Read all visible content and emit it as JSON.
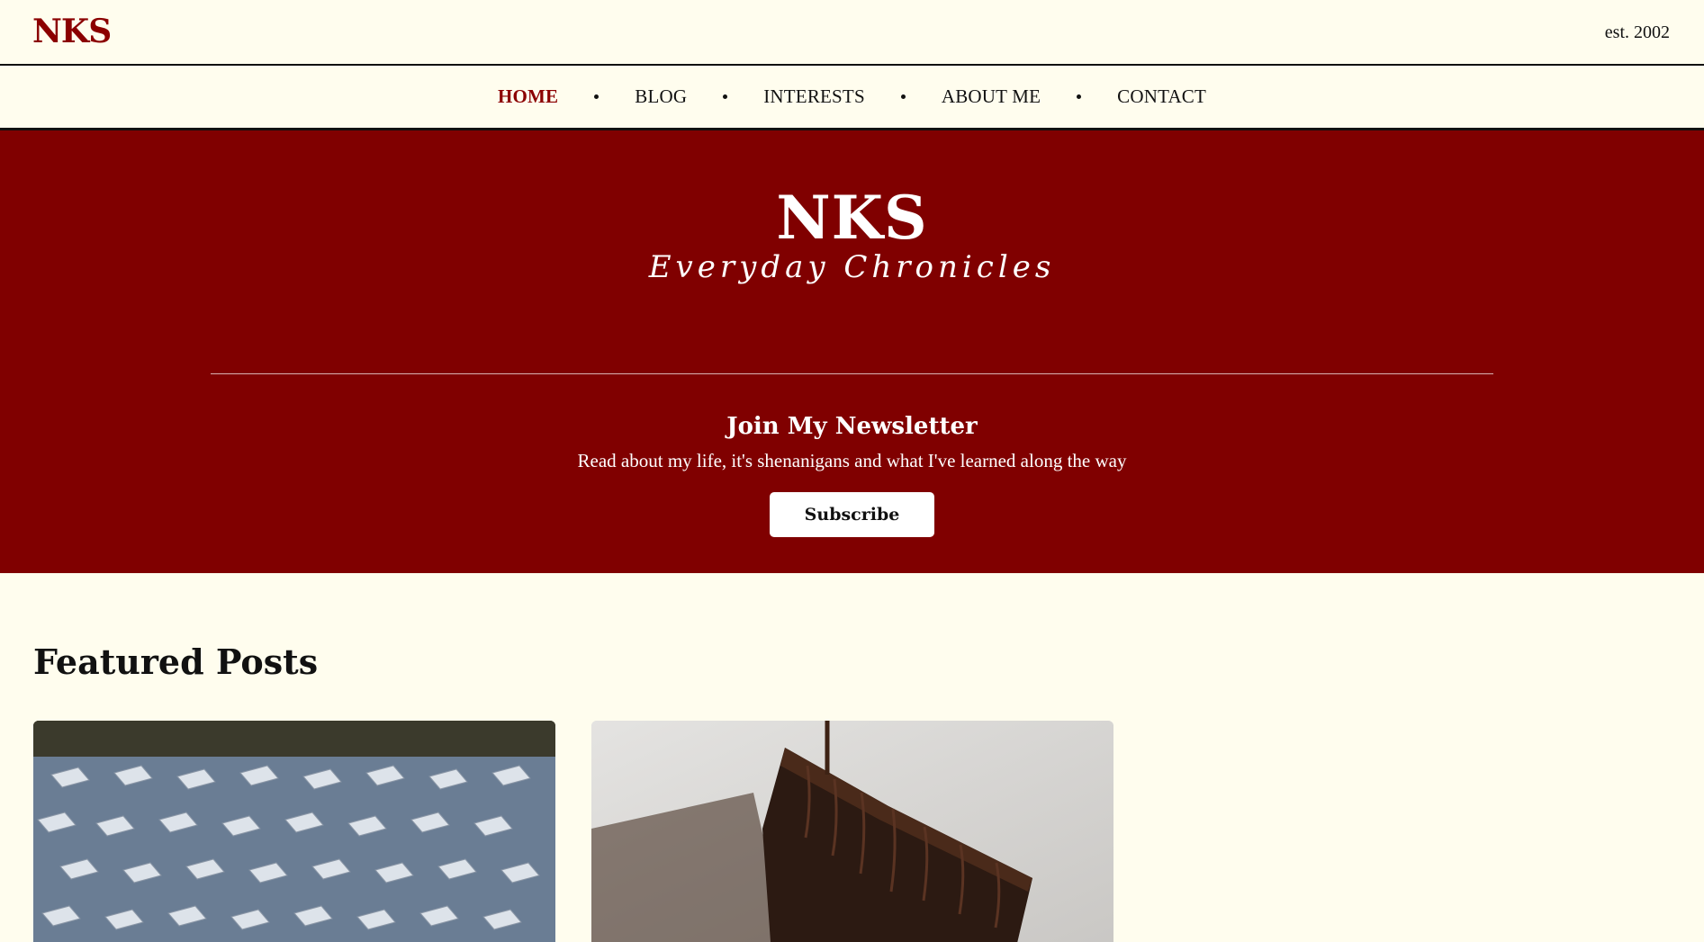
{
  "header": {
    "brand": "NKS",
    "established": "est. 2002"
  },
  "nav": {
    "items": [
      {
        "label": "HOME",
        "active": true
      },
      {
        "label": "BLOG",
        "active": false
      },
      {
        "label": "INTERESTS",
        "active": false
      },
      {
        "label": "ABOUT ME",
        "active": false
      },
      {
        "label": "CONTACT",
        "active": false
      }
    ]
  },
  "hero": {
    "title": "NKS",
    "tagline": "Everyday Chronicles",
    "newsletter_title": "Join My Newsletter",
    "newsletter_subtitle": "Read about my life, it's shenanigans and what I've learned along the way",
    "subscribe_label": "Subscribe"
  },
  "featured": {
    "heading": "Featured Posts",
    "cards": [
      {
        "image": "graduation-caps-photo"
      },
      {
        "image": "chocolate-cake-photo"
      }
    ]
  },
  "colors": {
    "brand": "#8b0000",
    "hero_bg": "#800000",
    "page_bg": "#fffdee"
  }
}
